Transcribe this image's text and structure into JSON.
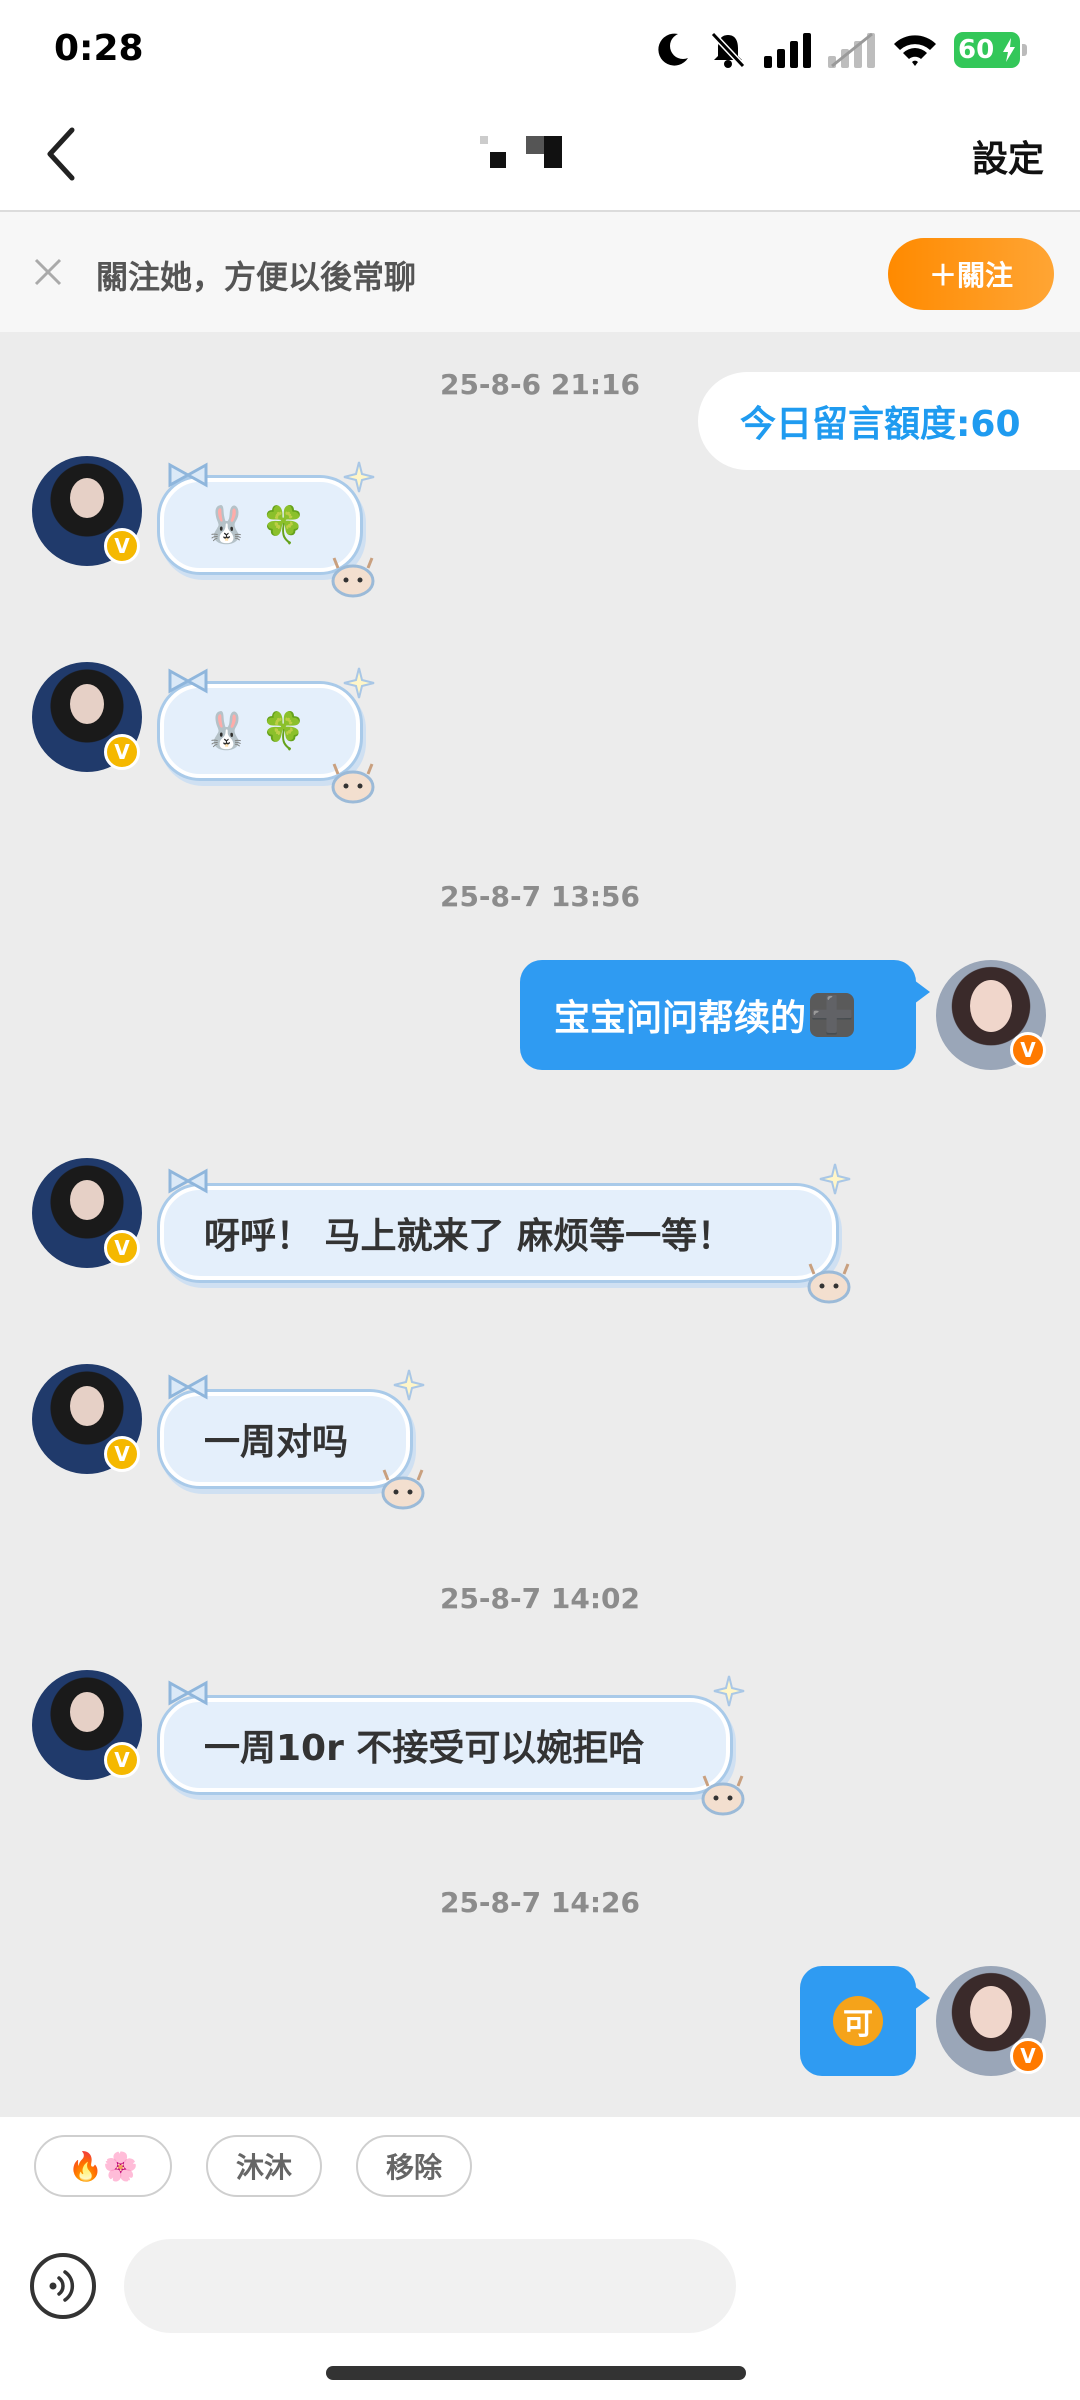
{
  "status_bar": {
    "time": "0:28",
    "battery": "60",
    "icons": [
      "moon-icon",
      "bell-muted-icon",
      "signal-icon",
      "signal-secondary-icon",
      "wifi-icon",
      "battery-charging-icon"
    ]
  },
  "nav": {
    "back_icon": "chevron-left-icon",
    "title": "",
    "settings_label": "設定"
  },
  "follow_banner": {
    "close_icon": "close-icon",
    "text": "關注她，方便以後常聊",
    "button_label": "＋關注"
  },
  "quota": "今日留言額度:60",
  "timestamps": [
    "25-8-6 21:16",
    "25-8-7 13:56",
    "25-8-7 14:02",
    "25-8-7 14:26"
  ],
  "messages": [
    {
      "side": "in",
      "text": "🐰 🍀"
    },
    {
      "side": "in",
      "text": "🐰 🍀"
    },
    {
      "side": "out",
      "text": "宝宝问问帮续的",
      "emoji": "➕"
    },
    {
      "side": "in",
      "text": "呀呼！ 马上就来了 麻烦等一等！"
    },
    {
      "side": "in",
      "text": "一周对吗"
    },
    {
      "side": "in",
      "text": "一周10r 不接受可以婉拒哈"
    },
    {
      "side": "out",
      "text": "可"
    }
  ],
  "verify_badge": "V",
  "quick_replies": [
    "🔥🌸",
    "沐沐",
    "移除"
  ],
  "input": {
    "placeholder": "",
    "voice_icon": "voice-icon"
  },
  "colors": {
    "accent_blue": "#2f9bf2",
    "follow_orange": "#ff8a00",
    "chat_background": "#ececec",
    "incoming_bubble": "#e4effb"
  }
}
